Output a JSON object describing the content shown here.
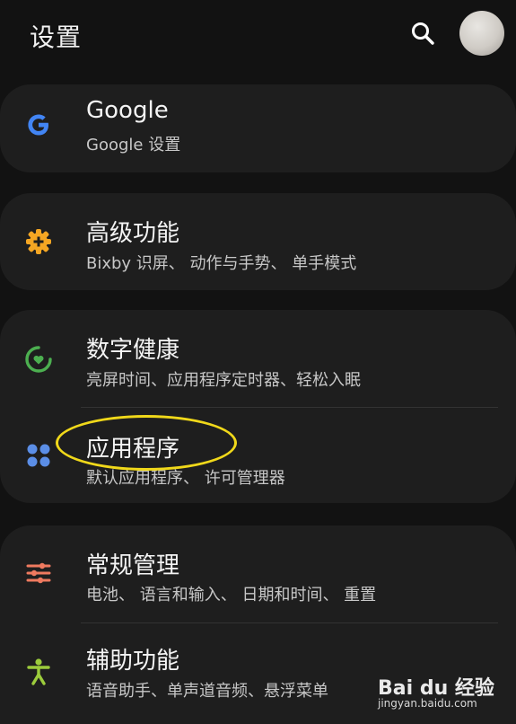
{
  "header": {
    "title": "设置",
    "search_icon": "search-icon",
    "avatar": "avatar"
  },
  "colors": {
    "background": "#121212",
    "card": "#1e1e1e",
    "google_blue": "#4285f4",
    "advanced_orange": "#f5a623",
    "wellbeing_green": "#4caf50",
    "apps_blue": "#5b8ee6",
    "general_red": "#ef7a5f",
    "accessibility_green": "#9ccc3c",
    "highlight": "#f0d81a"
  },
  "items": [
    {
      "title": "Google",
      "subtitle": "Google 设置",
      "icon": "google-icon"
    },
    {
      "title": "高级功能",
      "subtitle": "Bixby 识屏、 动作与手势、 单手模式",
      "icon": "gear-plus-icon"
    },
    {
      "title": "数字健康",
      "subtitle": "亮屏时间、应用程序定时器、轻松入眠",
      "icon": "wellbeing-icon"
    },
    {
      "title": "应用程序",
      "subtitle": "默认应用程序、 许可管理器",
      "icon": "apps-grid-icon"
    },
    {
      "title": "常规管理",
      "subtitle": "电池、 语言和输入、 日期和时间、 重置",
      "icon": "sliders-icon"
    },
    {
      "title": "辅助功能",
      "subtitle": "语音助手、单声道音频、悬浮菜单",
      "icon": "accessibility-icon"
    }
  ],
  "watermark": {
    "logo": "Bai du 经验",
    "url": "jingyan.baidu.com"
  }
}
